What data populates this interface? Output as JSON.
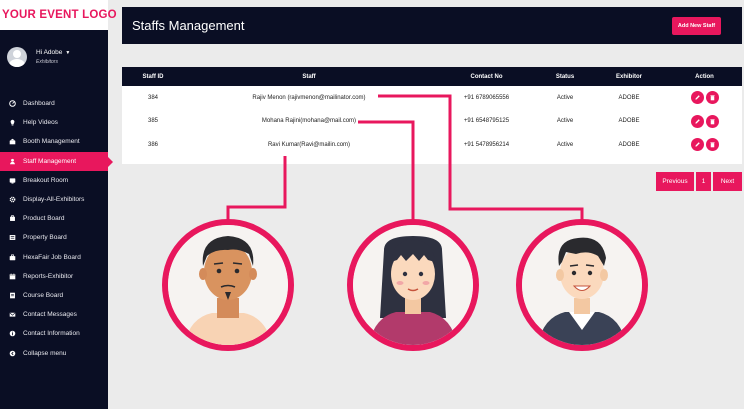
{
  "logo": "YOUR EVENT LOGO",
  "user": {
    "name": "Hi Adobe",
    "role": "Exhibitors"
  },
  "nav": [
    {
      "label": "Dashboard",
      "icon": "dashboard-icon",
      "active": false
    },
    {
      "label": "Help Videos",
      "icon": "bulb-icon",
      "active": false
    },
    {
      "label": "Booth Management",
      "icon": "booth-icon",
      "active": false
    },
    {
      "label": "Staff Management",
      "icon": "staff-icon",
      "active": true
    },
    {
      "label": "Breakout Room",
      "icon": "room-icon",
      "active": false
    },
    {
      "label": "Display-All-Exhibitors",
      "icon": "gear-icon",
      "active": false
    },
    {
      "label": "Product Board",
      "icon": "product-icon",
      "active": false
    },
    {
      "label": "Property Board",
      "icon": "property-icon",
      "active": false
    },
    {
      "label": "HexaFair Job Board",
      "icon": "job-icon",
      "active": false
    },
    {
      "label": "Reports-Exhibitor",
      "icon": "calendar-icon",
      "active": false
    },
    {
      "label": "Course Board",
      "icon": "course-icon",
      "active": false
    },
    {
      "label": "Contact Messages",
      "icon": "mail-icon",
      "active": false
    },
    {
      "label": "Contact Information",
      "icon": "info-icon",
      "active": false
    },
    {
      "label": "Collapse menu",
      "icon": "collapse-icon",
      "active": false
    }
  ],
  "header": {
    "title": "Staffs Management",
    "add_button": "Add New Staff"
  },
  "table": {
    "columns": [
      "Staff ID",
      "Staff",
      "Contact No",
      "Status",
      "Exhibitor",
      "Action"
    ],
    "rows": [
      {
        "id": "384",
        "staff": "Rajiv Menon (rajivmenon@mailinator.com)",
        "contact": "+91 6789065556",
        "status": "Active",
        "exhibitor": "ADOBE"
      },
      {
        "id": "385",
        "staff": "Mohana Rajini(mohana@mail.com)",
        "contact": "+91 6548795125",
        "status": "Active",
        "exhibitor": "ADOBE"
      },
      {
        "id": "386",
        "staff": "Ravi Kumar(Ravi@mailin.com)",
        "contact": "+91 5478956214",
        "status": "Active",
        "exhibitor": "ADOBE"
      }
    ]
  },
  "pagination": {
    "previous": "Previous",
    "current": "1",
    "next": "Next"
  },
  "colors": {
    "accent": "#e8175d",
    "dark": "#0a0e24",
    "background": "#ebebeb"
  }
}
